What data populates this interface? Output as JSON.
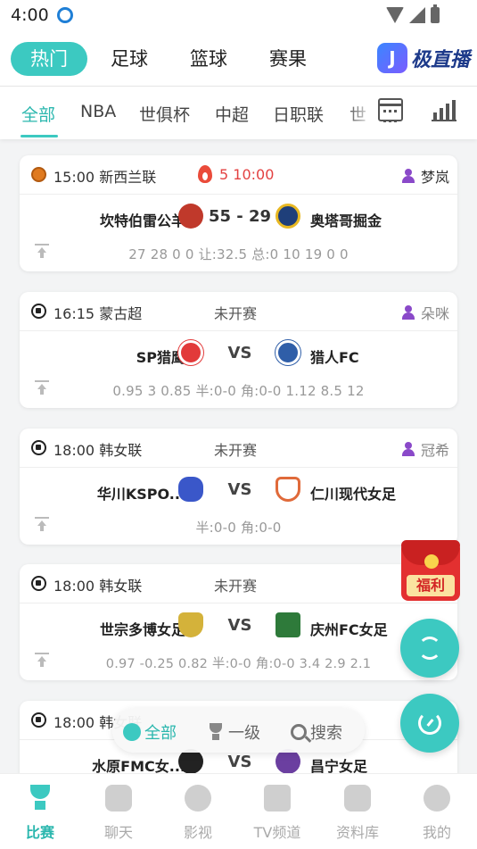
{
  "status_bar": {
    "time": "4:00"
  },
  "top_tabs": [
    {
      "label": "热门",
      "active": true
    },
    {
      "label": "足球",
      "active": false
    },
    {
      "label": "篮球",
      "active": false
    },
    {
      "label": "赛果",
      "active": false
    }
  ],
  "brand": {
    "logo_letter": "J",
    "name": "极直播"
  },
  "sub_tabs": [
    {
      "label": "全部",
      "active": true
    },
    {
      "label": "NBA",
      "active": false
    },
    {
      "label": "世俱杯",
      "active": false
    },
    {
      "label": "中超",
      "active": false
    },
    {
      "label": "日职联",
      "active": false
    },
    {
      "label": "世",
      "active": false
    }
  ],
  "matches": [
    {
      "sport": "basketball",
      "time_league": "15:00 新西兰联",
      "status": "5 10:00",
      "live": true,
      "anchor": "梦岚",
      "home": "坎特伯雷公羊",
      "center": "55 - 29",
      "away": "奥塔哥掘金",
      "odds": "27 28 0 0 让:32.5 总:0 10 19 0 0",
      "home_crest_color": "#c0392b",
      "away_crest_color": "#1f3f7a"
    },
    {
      "sport": "football",
      "time_league": "16:15 蒙古超",
      "status": "未开赛",
      "live": false,
      "anchor": "朵咪",
      "home": "SP猎鹰",
      "center": "VS",
      "away": "猎人FC",
      "odds": "0.95 3 0.85 半:0-0 角:0-0 1.12 8.5 12",
      "home_crest_color": "#e23a3a",
      "away_crest_color": "#2f5ea8"
    },
    {
      "sport": "football",
      "time_league": "18:00 韩女联",
      "status": "未开赛",
      "live": false,
      "anchor": "冠希",
      "home": "华川KSPO...",
      "center": "VS",
      "away": "仁川现代女足",
      "odds": "半:0-0 角:0-0",
      "home_crest_color": "#3a57c9",
      "away_crest_color": "#e06a3a"
    },
    {
      "sport": "football",
      "time_league": "18:00 韩女联",
      "status": "未开赛",
      "live": false,
      "anchor": "",
      "home": "世宗多博女足",
      "center": "VS",
      "away": "庆州FC女足",
      "odds": "0.97 -0.25 0.82 半:0-0 角:0-0 3.4 2.9 2.1",
      "home_crest_color": "#d4b23a",
      "away_crest_color": "#2e7a3a"
    },
    {
      "sport": "football",
      "time_league": "18:00 韩女联",
      "status": "",
      "live": false,
      "anchor": "",
      "home": "水原FMC女...",
      "center": "VS",
      "away": "昌宁女足",
      "odds": "",
      "home_crest_color": "#222222",
      "away_crest_color": "#6b3fa0"
    }
  ],
  "gift": {
    "label": "福利"
  },
  "filter": [
    {
      "label": "全部",
      "active": true
    },
    {
      "label": "一级",
      "active": false
    },
    {
      "label": "搜索",
      "active": false
    }
  ],
  "bottom_nav": [
    {
      "label": "比赛",
      "active": true
    },
    {
      "label": "聊天",
      "active": false
    },
    {
      "label": "影视",
      "active": false
    },
    {
      "label": "TV频道",
      "active": false
    },
    {
      "label": "资料库",
      "active": false
    },
    {
      "label": "我的",
      "active": false
    }
  ],
  "colors": {
    "accent": "#3cc9c1",
    "live": "#e34141",
    "anchor_icon": "#8a49c9"
  }
}
